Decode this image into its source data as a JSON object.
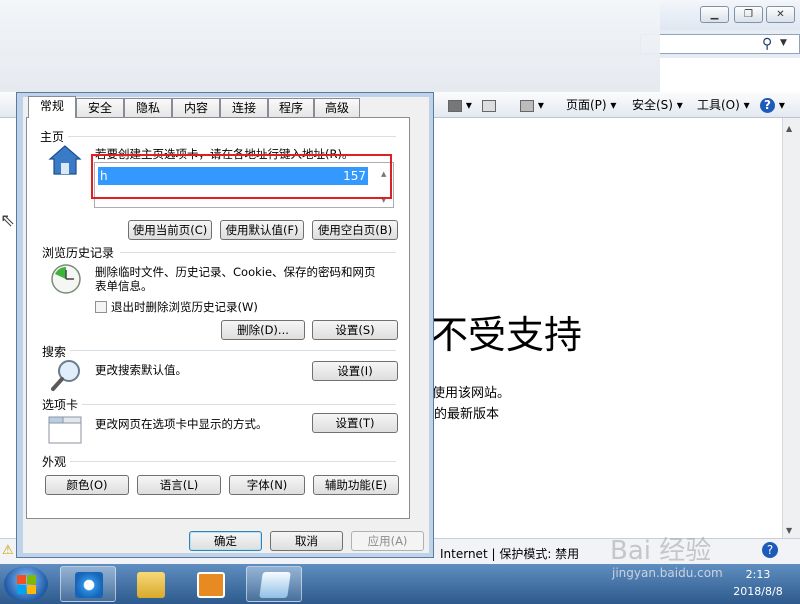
{
  "browser": {
    "commands": {
      "page_label": "页面(P)",
      "safety_label": "安全(S)",
      "tools_label": "工具(O)",
      "help_label": "?"
    },
    "content": {
      "heading": "不受支持",
      "line1": "使用该网站。",
      "line2": "的最新版本"
    },
    "status": {
      "zone": "Internet | 保护模式: 禁用"
    }
  },
  "dialog": {
    "tabs": [
      "常规",
      "安全",
      "隐私",
      "内容",
      "连接",
      "程序",
      "高级"
    ],
    "home": {
      "group_label": "主页",
      "instruction": "若要创建主页选项卡，请在各地址行键入地址(R)。",
      "url_start": "h",
      "url_end": "157",
      "buttons": [
        "使用当前页(C)",
        "使用默认值(F)",
        "使用空白页(B)"
      ]
    },
    "history": {
      "group_label": "浏览历史记录",
      "desc_line1": "删除临时文件、历史记录、Cookie、保存的密码和网页",
      "desc_line2": "表单信息。",
      "checkbox_label": "退出时删除浏览历史记录(W)",
      "delete_button": "删除(D)...",
      "settings_button": "设置(S)"
    },
    "search": {
      "group_label": "搜索",
      "desc": "更改搜索默认值。",
      "settings_button": "设置(I)"
    },
    "tabs_group": {
      "group_label": "选项卡",
      "desc": "更改网页在选项卡中显示的方式。",
      "settings_button": "设置(T)"
    },
    "appearance": {
      "group_label": "外观",
      "buttons": [
        "颜色(O)",
        "语言(L)",
        "字体(N)",
        "辅助功能(E)"
      ]
    },
    "footer": {
      "ok": "确定",
      "cancel": "取消",
      "apply": "应用(A)"
    }
  },
  "taskbar": {
    "tray_time": "2:13",
    "tray_date": "2018/8/8"
  },
  "watermark": {
    "brand": "Bai 经验",
    "url": "jingyan.baidu.com"
  }
}
